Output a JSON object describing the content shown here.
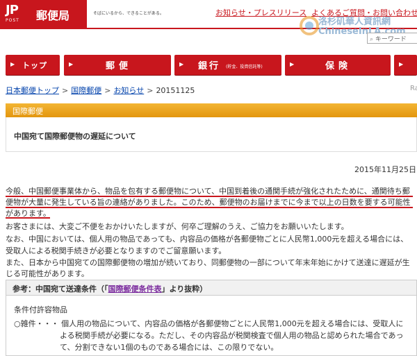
{
  "header": {
    "logo_mark": "JP",
    "logo_post": "POST",
    "logo_text": "郵便局",
    "tagline": "そばにいるから、できることがある。",
    "links": [
      "お知らせ・プレスリリース",
      "よくあるご質問・お問い合わせ"
    ],
    "search_placeholder": "キーワード"
  },
  "watermark": {
    "line1": "洛杉矶華人資訊網",
    "line2": "ChineseInLA.com"
  },
  "nav": {
    "items": [
      {
        "label": "トップ",
        "sub": ""
      },
      {
        "label": "郵便",
        "sub": ""
      },
      {
        "label": "銀行",
        "sub": "(貯金、投資信託等)"
      },
      {
        "label": "保険",
        "sub": ""
      }
    ]
  },
  "breadcrumb": {
    "items": [
      "日本郵便トップ",
      "国際郵便",
      "お知らせ"
    ],
    "current": "20151125",
    "right_fragment": "Ra"
  },
  "section": {
    "header": "国際郵便",
    "title": "中国宛て国際郵便物の遅延について"
  },
  "notice": {
    "date": "2015年11月25日",
    "lines": [
      "今般、中国郵便事業体から、物品を包有する郵便物について、中国到着後の通関手続が強化されたために、通関待ち郵",
      "便物が大量に発生している旨の連絡がありました。このため、郵便物のお届けまでに今まで以上の日数を要する可能性",
      "があります。",
      "お客さまには、大変ご不便をおかけいたしますが、何卒ご理解のうえ、ご協力をお願いいたします。",
      "なお、中国においては、個人用の物品であっても、内容品の価格が各郵便物ごとに人民幣1,000元を超える場合には、",
      "受取人による税関手続きが必要となりますのでご留意願います。",
      "また、日本から中国宛ての国際郵便物の増加が続いており、同郵便物の一部について年末年始にかけて送達に遅延が生",
      "じる可能性があります。"
    ]
  },
  "conditions": {
    "title_pre": "参考：中国宛て送達条件（「",
    "title_link": "国際郵便条件表",
    "title_post": "」より抜粋）",
    "subtitle": "条件付許容物品",
    "lines": [
      "○雑件・・・ 個人用の物品について、内容品の価格が各郵便物ごとに人民幣1,000元を超える場合には、受取人に",
      "よる税関手続が必要になる。ただし、その内容品が税関検査で個人用の物品と認められた場合であっ",
      "て、分割できない1個のものである場合には、この限りでない。"
    ]
  },
  "colors": {
    "brand_red": "#c8161d",
    "section_orange": "#eea21f",
    "link_blue": "#0645ad",
    "link_purple": "#7b2c9e"
  }
}
